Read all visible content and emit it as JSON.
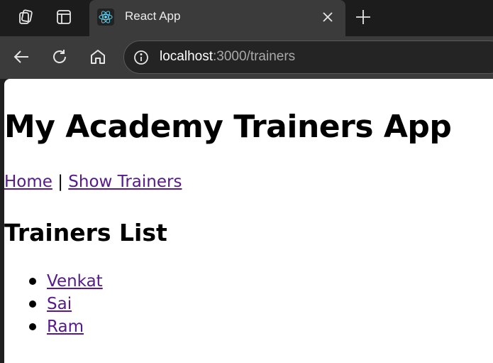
{
  "browser": {
    "tab": {
      "title": "React App",
      "favicon": "react-logo-icon"
    },
    "address_bar": {
      "host": "localhost",
      "path": ":3000/trainers"
    },
    "accent": "#61dafb"
  },
  "page": {
    "title": "My Academy Trainers App",
    "nav": {
      "home_label": "Home",
      "separator": "|",
      "show_trainers_label": "Show Trainers"
    },
    "list_heading": "Trainers List",
    "trainers": [
      {
        "name": "Venkat"
      },
      {
        "name": "Sai"
      },
      {
        "name": "Ram"
      }
    ],
    "link_color": "#551a8b"
  }
}
